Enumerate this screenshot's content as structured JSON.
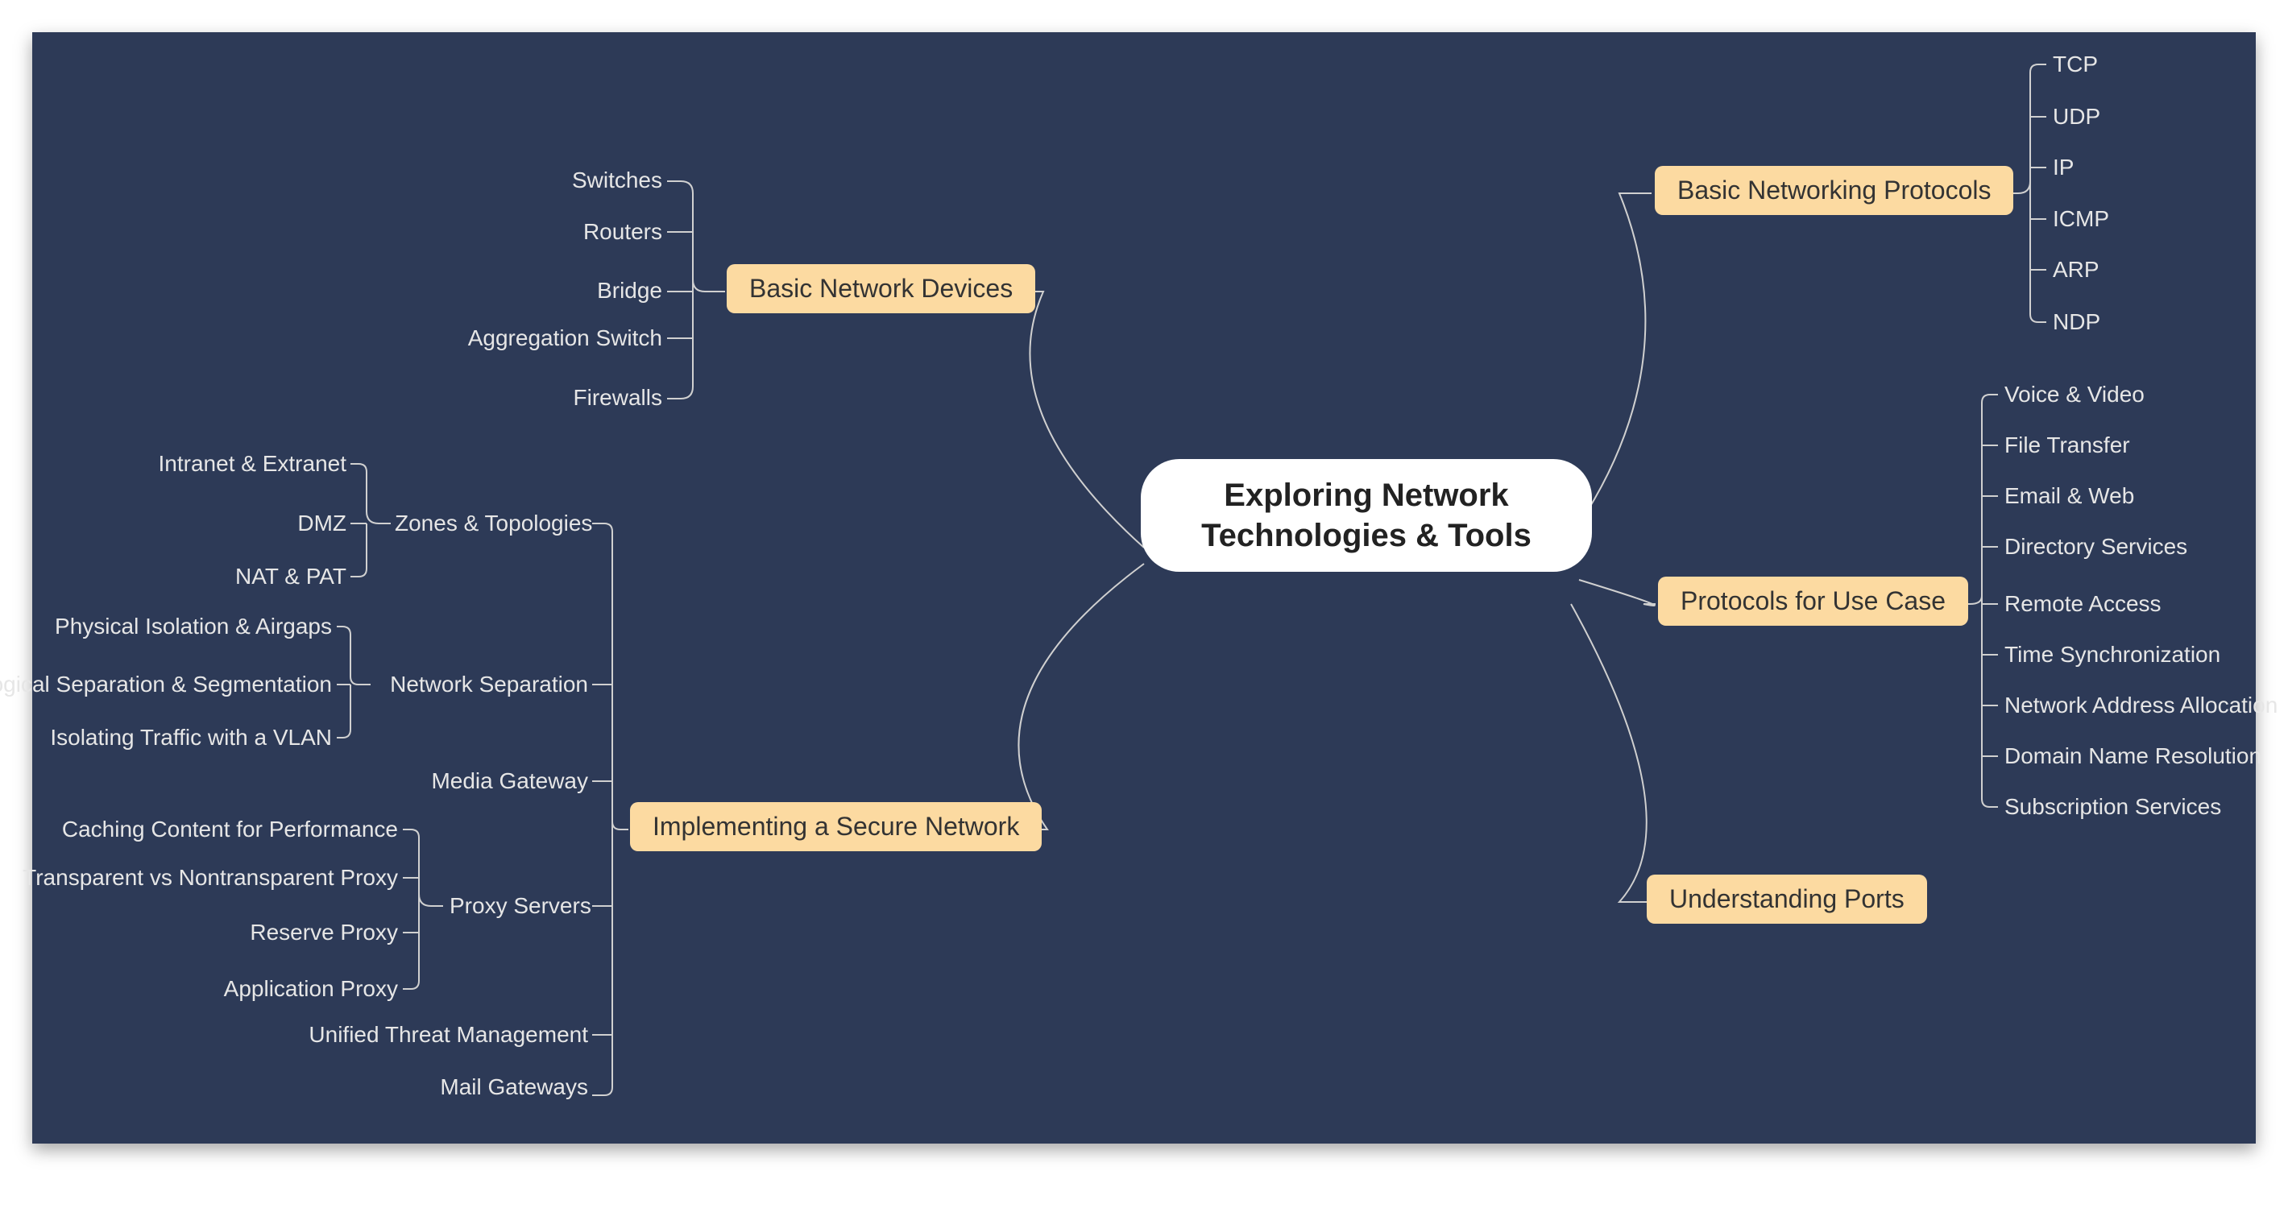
{
  "center": {
    "line1": "Exploring Network",
    "line2": "Technologies & Tools"
  },
  "branches": {
    "basic_devices": {
      "label": "Basic Network Devices",
      "leaves": [
        "Switches",
        "Routers",
        "Bridge",
        "Aggregation Switch",
        "Firewalls"
      ]
    },
    "secure_network": {
      "label": "Implementing a Secure Network",
      "children": {
        "zones": {
          "label": "Zones & Topologies",
          "leaves": [
            "Intranet & Extranet",
            "DMZ",
            "NAT & PAT"
          ]
        },
        "separation": {
          "label": "Network Separation",
          "leaves": [
            "Physical Isolation & Airgaps",
            "Logical Separation & Segmentation",
            "Isolating Traffic with a VLAN"
          ]
        },
        "media": {
          "label": "Media Gateway"
        },
        "proxy": {
          "label": "Proxy Servers",
          "leaves": [
            "Caching Content for Performance",
            "Transparent vs Nontransparent Proxy",
            "Reserve Proxy",
            "Application Proxy"
          ]
        },
        "utm": {
          "label": "Unified Threat Management"
        },
        "mail": {
          "label": "Mail Gateways"
        }
      }
    },
    "protocols": {
      "label": "Basic Networking Protocols",
      "leaves": [
        "TCP",
        "UDP",
        "IP",
        "ICMP",
        "ARP",
        "NDP"
      ]
    },
    "usecase": {
      "label": "Protocols for Use Case",
      "leaves": [
        "Voice & Video",
        "File Transfer",
        "Email & Web",
        "Directory Services",
        "Remote Access",
        "Time Synchronization",
        "Network Address Allocation",
        "Domain Name Resolution",
        "Subscription Services"
      ]
    },
    "ports": {
      "label": "Understanding Ports"
    }
  }
}
